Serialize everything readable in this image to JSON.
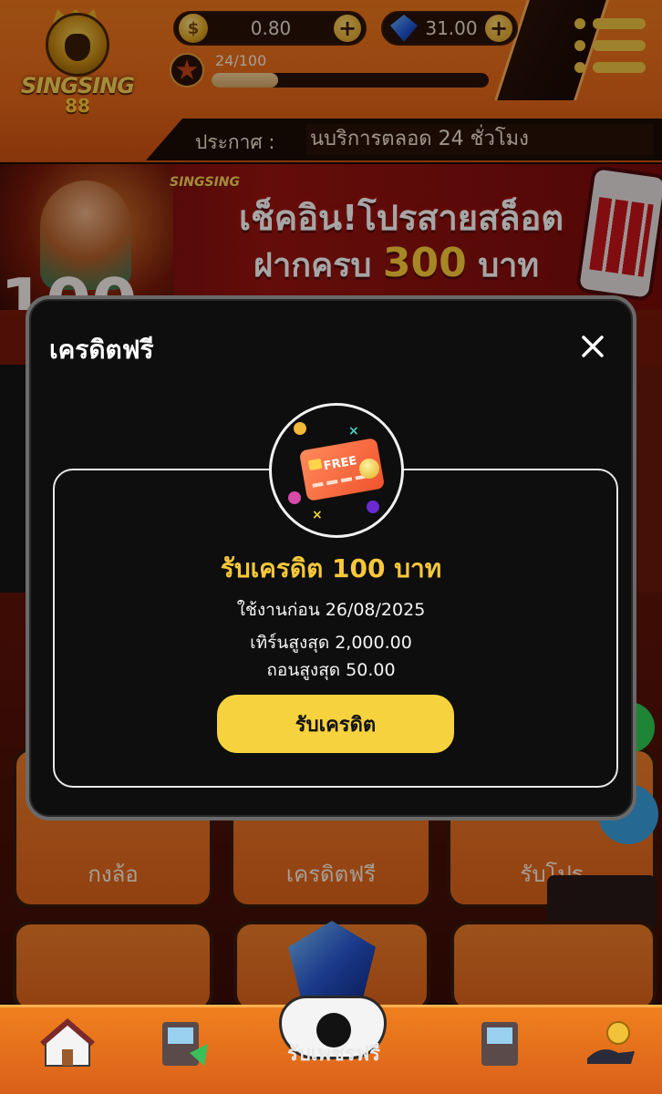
{
  "header": {
    "brand": "SINGSING",
    "brand_number": "88",
    "coin_balance": "0.80",
    "gem_balance": "31.00",
    "level_progress_text": "24/100",
    "level_progress_fraction": 0.24,
    "notice_label": "ประกาศ :",
    "notice_text": "นบริการตลอด 24 ชั่วโมง"
  },
  "banner": {
    "left_number": "100",
    "logo": "SINGSING",
    "title": "เช็คอิน!โปรสายสล็อต",
    "subtitle_prefix": "ฝากครบ",
    "subtitle_amount": "300",
    "subtitle_suffix": "บาท"
  },
  "background_cards": {
    "row1": [
      "กงล้อ",
      "เครดิตฟรี",
      "รับโปร"
    ]
  },
  "modal": {
    "title": "เครดิตฟรี",
    "icon_text": "FREE",
    "reward_title": "รับเครดิต 100 บาท",
    "use_before": "ใช้งานก่อน 26/08/2025",
    "max_turnover": "เทิร์นสูงสุด 2,000.00",
    "max_withdraw": "ถอนสูงสุด 50.00",
    "claim_button": "รับเครดิต"
  },
  "bottom_nav": {
    "center_label": "รับเพชรฟรี"
  },
  "colors": {
    "accent_yellow": "#f6d23e",
    "reward_gold": "#f7c83a",
    "header_orange": "#e8681a",
    "modal_bg": "#0e0e0e"
  }
}
